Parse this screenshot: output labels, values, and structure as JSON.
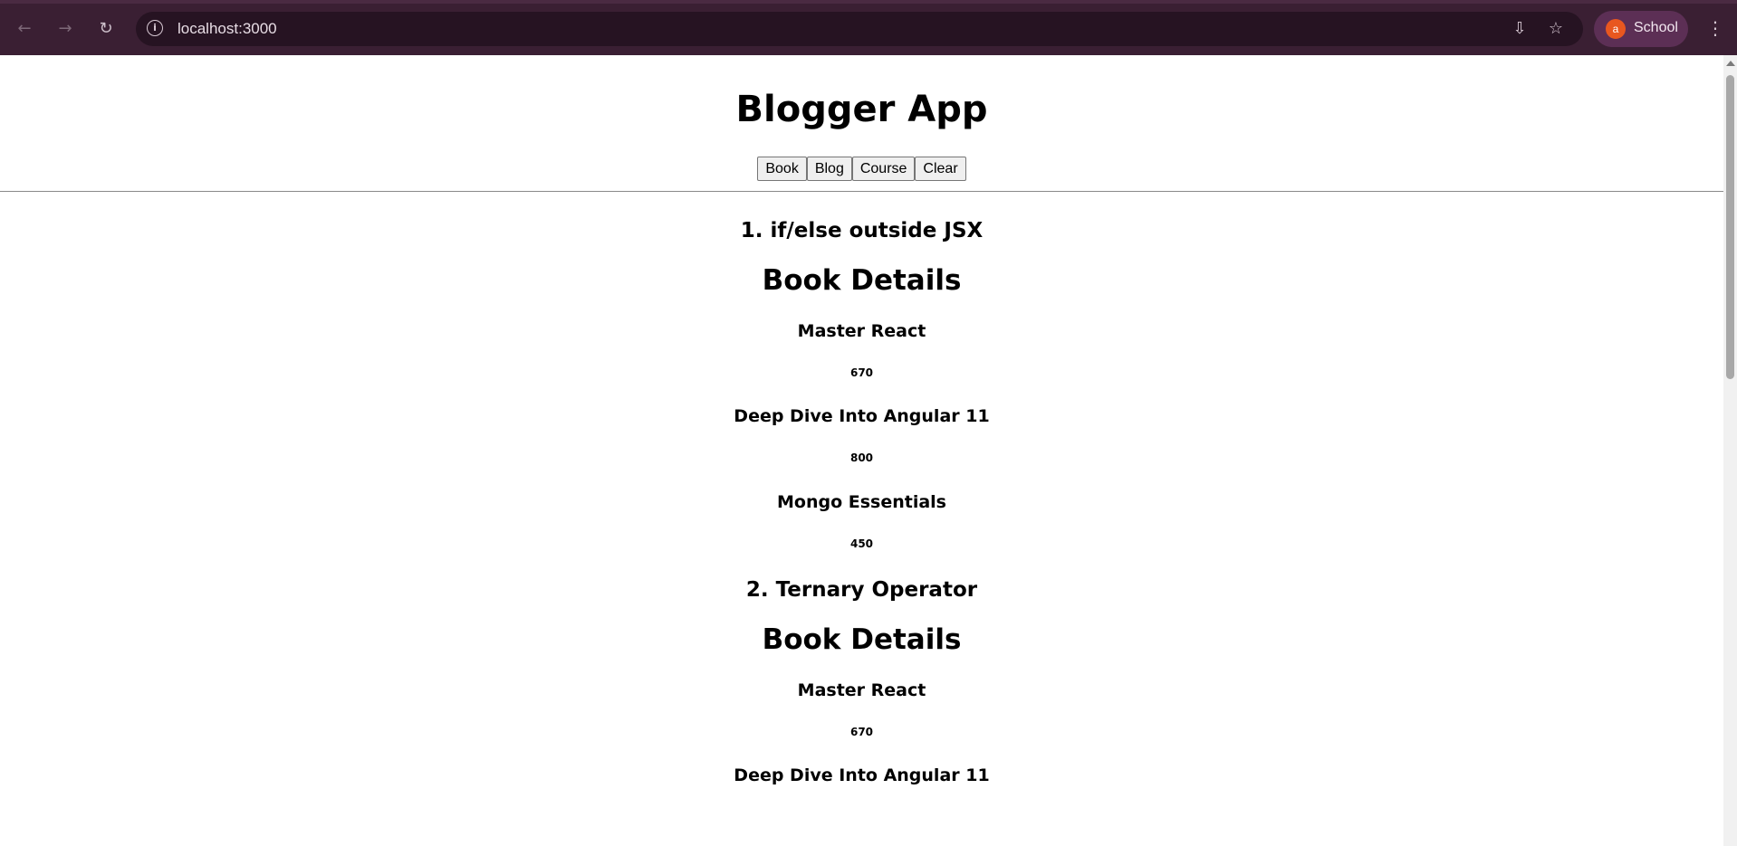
{
  "browser": {
    "url": "localhost:3000",
    "profile_initial": "a",
    "profile_name": "School"
  },
  "app": {
    "title": "Blogger App",
    "buttons": [
      "Book",
      "Blog",
      "Course",
      "Clear"
    ]
  },
  "sections": [
    {
      "heading": "1. if/else outside JSX",
      "details_title": "Book Details",
      "books": [
        {
          "name": "Master React",
          "price": "670"
        },
        {
          "name": "Deep Dive Into Angular 11",
          "price": "800"
        },
        {
          "name": "Mongo Essentials",
          "price": "450"
        }
      ]
    },
    {
      "heading": "2. Ternary Operator",
      "details_title": "Book Details",
      "books": [
        {
          "name": "Master React",
          "price": "670"
        },
        {
          "name": "Deep Dive Into Angular 11",
          "price": ""
        }
      ]
    }
  ],
  "colors": {
    "chrome_bg": "#3a1f33",
    "omnibox_bg": "#261322",
    "profile_bg": "#5c2f55",
    "avatar_bg": "#e8571f"
  },
  "icons": [
    "back-arrow-icon",
    "forward-arrow-icon",
    "reload-icon",
    "site-info-icon",
    "install-app-icon",
    "bookmark-star-icon",
    "kebab-menu-icon"
  ]
}
